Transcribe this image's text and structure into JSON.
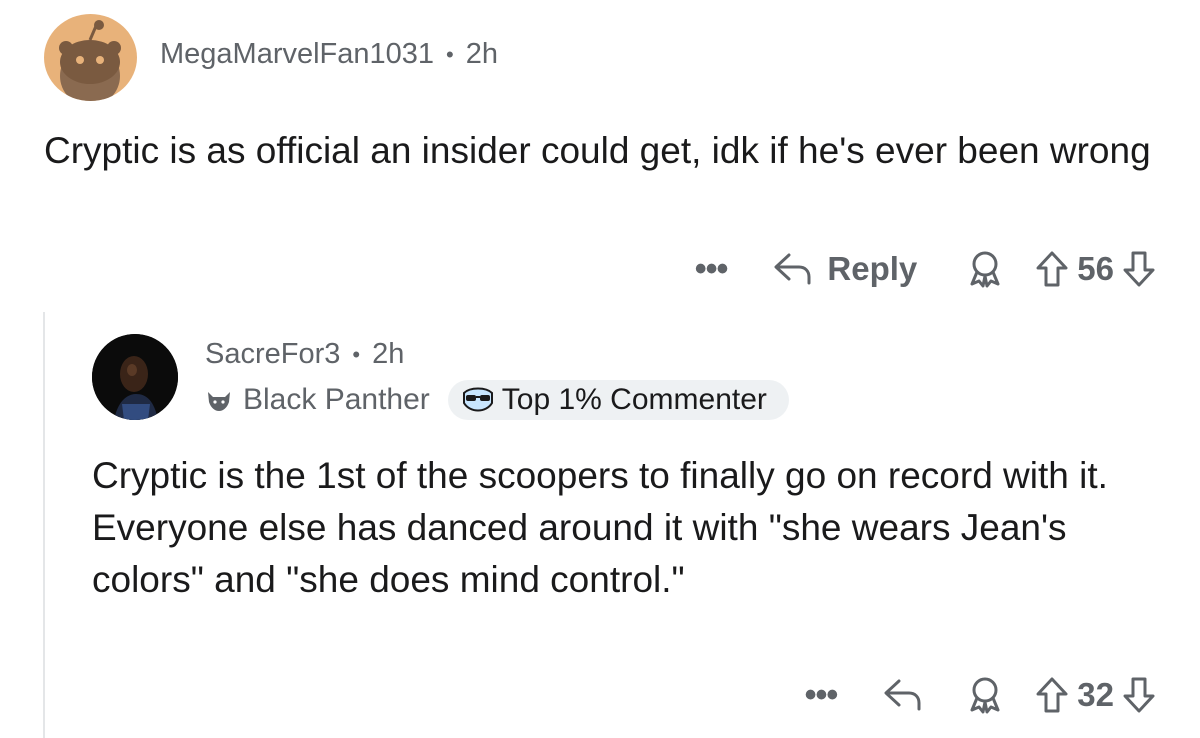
{
  "comments": [
    {
      "username": "MegaMarvelFan1031",
      "separator": "•",
      "age": "2h",
      "body": "Cryptic is as official an insider could get, idk if he's ever been wrong",
      "actions": {
        "more": "•••",
        "reply": "Reply",
        "score": "56"
      }
    },
    {
      "username": "SacreFor3",
      "separator": "•",
      "age": "2h",
      "flair": "Black Panther",
      "badge": "Top 1% Commenter",
      "body": "Cryptic is the 1st of the scoopers to finally go on record with it. Everyone else has danced around it with \"she wears Jean's colors\" and \"she does mind control.\"",
      "actions": {
        "more": "•••",
        "score": "32"
      }
    }
  ],
  "colors": {
    "avatar1_bg": "#E8B27A",
    "meta_text": "#5f6368",
    "badge_bg": "#eef1f3",
    "thread_line": "#e4e6e8"
  },
  "icons": [
    "snoo-avatar",
    "reply-arrow-icon",
    "award-icon",
    "upvote-icon",
    "downvote-icon",
    "panther-flair-icon",
    "sunglasses-badge-icon"
  ]
}
